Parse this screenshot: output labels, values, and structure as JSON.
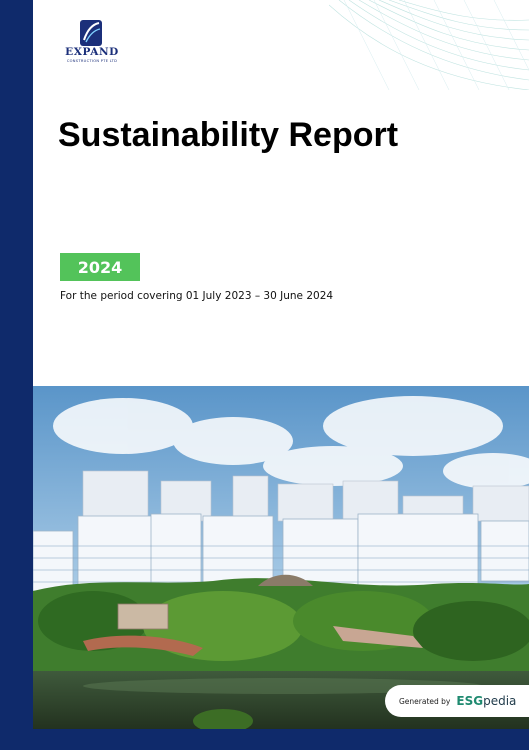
{
  "logo": {
    "name": "EXPAND",
    "subtitle": "CONSTRUCTION PTE LTD",
    "icon": "expand-logo-icon"
  },
  "report": {
    "title": "Sustainability Report",
    "year": "2024",
    "period": "For the period covering 01 July 2023 – 30 June 2024"
  },
  "footer": {
    "generated_by": "Generated by",
    "brand_part1": "ESG",
    "brand_part2": "pedia"
  },
  "colors": {
    "navy": "#0f2a6b",
    "green_badge": "#53c35a",
    "brand_green": "#1f8a70"
  }
}
